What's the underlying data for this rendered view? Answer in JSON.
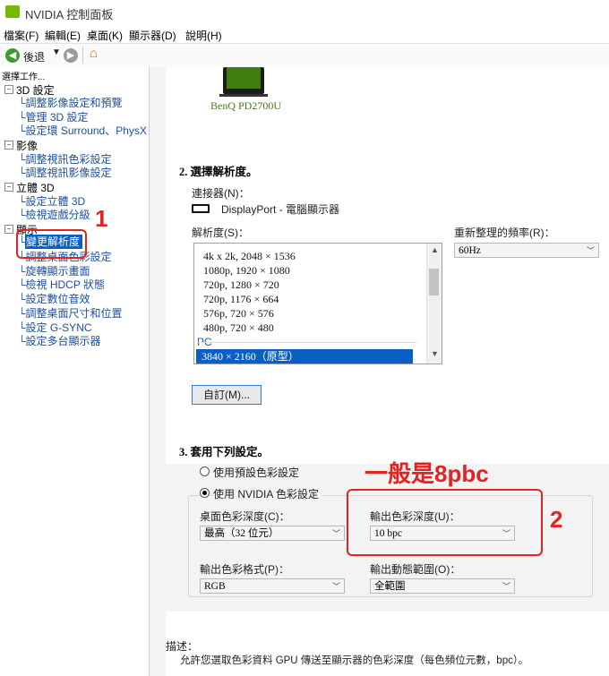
{
  "window": {
    "title": "NVIDIA 控制面板"
  },
  "menu": [
    "檔案(F)",
    "編輯(E)",
    "桌面(K)",
    "顯示器(D)",
    "說明(H)"
  ],
  "toolbar": {
    "back_label": "後退"
  },
  "tree": {
    "header": "選擇工作...",
    "sections": [
      {
        "label": "3D 設定",
        "items": [
          "調整影像設定和預覽",
          "管理 3D 設定",
          "設定環 Surround、PhysX"
        ]
      },
      {
        "label": "影像",
        "items": [
          "調整視訊色彩設定",
          "調整視訊影像設定"
        ]
      },
      {
        "label": "立體 3D",
        "items": [
          "設定立體 3D",
          "檢視遊戲分級"
        ]
      },
      {
        "label": "顯示",
        "items": [
          "變更解析度",
          "調整桌面色彩設定",
          "旋轉顯示畫面",
          "檢視 HDCP 狀態",
          "設定數位音效",
          "調整桌面尺寸和位置",
          "設定 G-SYNC",
          "設定多台顯示器"
        ]
      }
    ]
  },
  "main": {
    "monitor_name": "BenQ PD2700U",
    "section2": {
      "title": "2. 選擇解析度。",
      "connector_label": "連接器(N)：",
      "connector_value": "DisplayPort - 電腦顯示器",
      "resolution_label": "解析度(S)：",
      "resolutions": [
        "4k x 2k, 2048 × 1536",
        "1080p, 1920 × 1080",
        "720p, 1280 × 720",
        "720p, 1176 × 664",
        "576p, 720 × 576",
        "480p, 720 × 480"
      ],
      "pc_group": "PC",
      "selected_resolution": "3840 × 2160（原型）",
      "refresh_label": "重新整理的頻率(R)：",
      "refresh_value": "60Hz",
      "custom_button": "自訂(M)..."
    },
    "section3": {
      "title": "3. 套用下列設定。",
      "radio_default": "使用預設色彩設定",
      "radio_nvidia": "使用 NVIDIA 色彩設定",
      "desktop_depth_label": "桌面色彩深度(C)：",
      "desktop_depth_value": "最高（32 位元）",
      "output_depth_label": "輸出色彩深度(U)：",
      "output_depth_value": "10 bpc",
      "output_format_label": "輸出色彩格式(P)：",
      "output_format_value": "RGB",
      "output_range_label": "輸出動態範圍(O)：",
      "output_range_value": "全範圍"
    },
    "description": {
      "label": "描述：",
      "text": "允許您選取色彩資料 GPU 傳送至顯示器的色彩深度（每色頻位元數，bpc）。"
    }
  },
  "annotations": {
    "step1": "1",
    "step2": "2",
    "note": "一般是8pbc"
  },
  "colors": {
    "nvidia_green": "#76b900",
    "selection_blue": "#0a5fc4",
    "annotation_red": "#e32222",
    "link_blue": "#1c4e9c"
  }
}
